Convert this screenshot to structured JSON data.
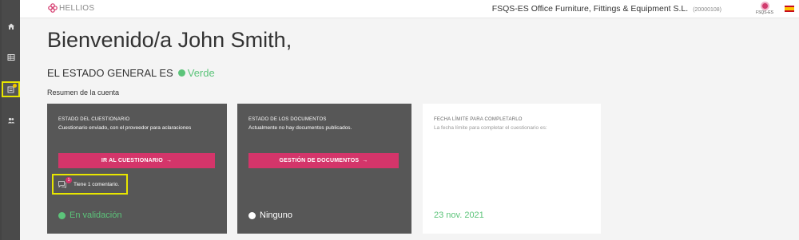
{
  "brand": {
    "name": "HELLIOS",
    "icon": "flower-icon",
    "color": "#d4356a"
  },
  "header": {
    "company": "FSQS-ES Office Furniture, Fittings & Equipment S.L.",
    "company_id": "(20000108)",
    "org_badge": "FSQS-ES",
    "flag_icon": "spain-flag-icon"
  },
  "sidebar": {
    "items": [
      {
        "icon": "home-icon"
      },
      {
        "icon": "table-icon"
      },
      {
        "icon": "questionnaire-icon",
        "active": true
      },
      {
        "icon": "users-icon"
      }
    ]
  },
  "main": {
    "welcome": "Bienvenido/a John Smith,",
    "status_label": "EL ESTADO GENERAL ES",
    "status_value": "Verde",
    "summary_label": "Resumen de la cuenta"
  },
  "cards": {
    "questionnaire": {
      "title": "ESTADO DEL CUESTIONARIO",
      "desc": "Cuestionario enviado, con el proveedor para aclaraciones",
      "button": "IR AL CUESTIONARIO",
      "comment_count": "1",
      "comment_text": "Tiene 1 comentario.",
      "status": "En validación"
    },
    "documents": {
      "title": "ESTADO DE LOS DOCUMENTOS",
      "desc": "Actualmente no hay documentos publicados.",
      "button": "GESTIÓN DE DOCUMENTOS",
      "status": "Ninguno"
    },
    "deadline": {
      "title": "FECHA LÍMITE PARA COMPLETARLO",
      "desc": "La fecha límite para completar el cuestionario es:",
      "date": "23 nov. 2021"
    }
  },
  "colors": {
    "accent": "#d4356a",
    "green": "#5cc47a",
    "highlight": "#e8e600"
  }
}
